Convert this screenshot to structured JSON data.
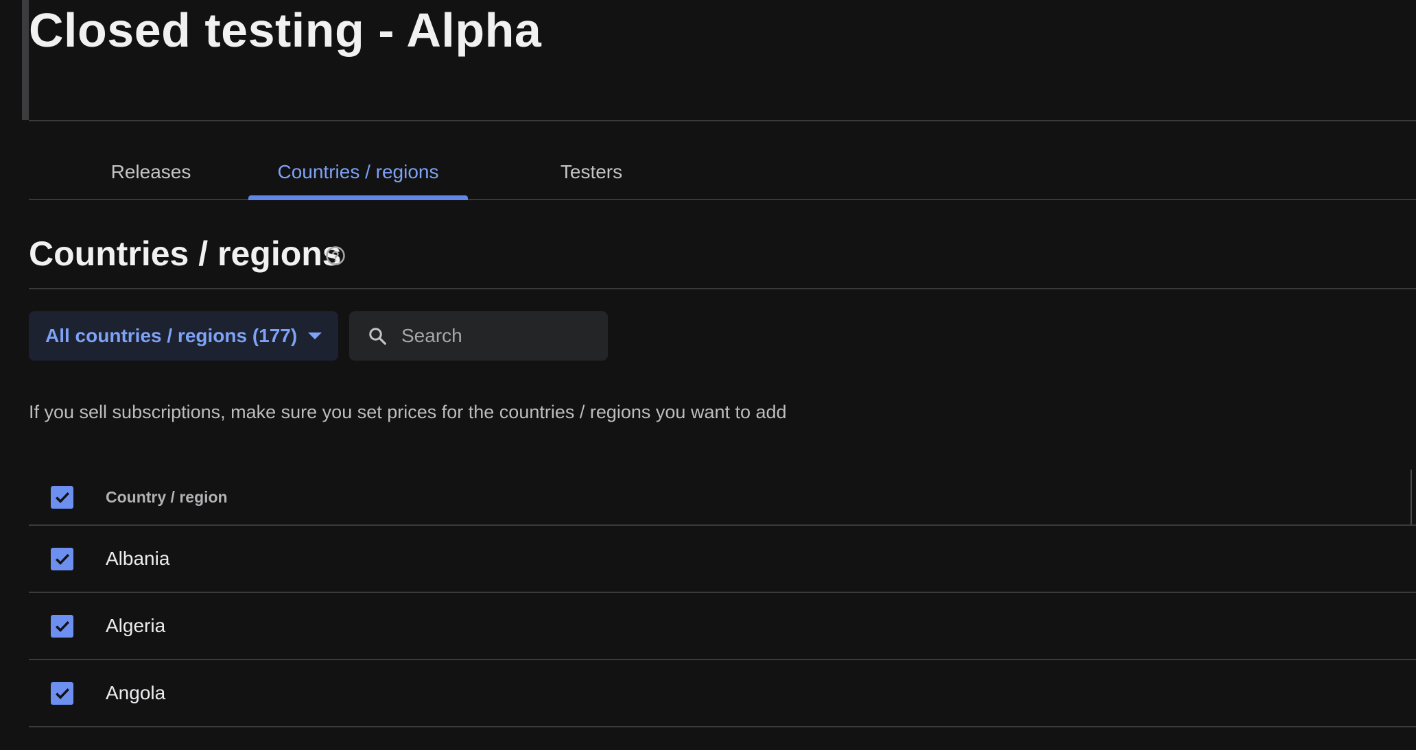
{
  "header": {
    "title": "Closed testing - Alpha"
  },
  "tabs": [
    {
      "label": "Releases",
      "active": false
    },
    {
      "label": "Countries / regions",
      "active": true
    },
    {
      "label": "Testers",
      "active": false
    }
  ],
  "section": {
    "title": "Countries / regions",
    "help_icon": "help-circle-icon"
  },
  "filter": {
    "label": "All countries / regions (177)",
    "icon": "caret-down-icon"
  },
  "search": {
    "placeholder": "Search",
    "value": "",
    "icon": "search-icon"
  },
  "notice": "If you sell subscriptions, make sure you set prices for the countries / regions you want to add",
  "table": {
    "header": {
      "label": "Country / region",
      "checked": true
    },
    "rows": [
      {
        "label": "Albania",
        "checked": true
      },
      {
        "label": "Algeria",
        "checked": true
      },
      {
        "label": "Angola",
        "checked": true
      }
    ]
  },
  "colors": {
    "accent": "#7ea2f5",
    "checkbox": "#6c8ff0",
    "background": "#121213"
  }
}
